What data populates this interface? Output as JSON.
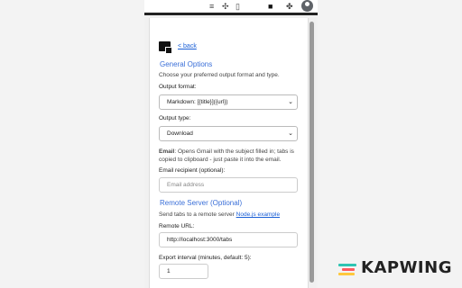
{
  "toolbar": {
    "icons": [
      "menu-icon",
      "puzzle-icon",
      "bookmark-icon",
      "extension-active-icon",
      "extensions-icon",
      "profile-icon"
    ]
  },
  "popup": {
    "back_label": "< back",
    "general": {
      "heading": "General Options",
      "description": "Choose your preferred output format and type.",
      "output_format_label": "Output format:",
      "output_format_value": "Markdown: [{title}]({url})",
      "output_type_label": "Output type:",
      "output_type_value": "Download",
      "email_note_bold": "Email",
      "email_note_rest": ": Opens Gmail with the subject filled in; tabs is copied to clipboard - just paste it into the email.",
      "email_recipient_label": "Email recipient (optional):",
      "email_placeholder": "Email address"
    },
    "remote": {
      "heading": "Remote Server (Optional)",
      "description_prefix": "Send tabs to a remote server ",
      "description_link": "Node.js example",
      "url_label": "Remote URL:",
      "url_value": "http://localhost:3000/tabs",
      "interval_label": "Export interval (minutes, default: 5):",
      "interval_value": "1"
    }
  },
  "watermark": {
    "text": "KAPWING",
    "colors": [
      "#2fc4b2",
      "#ff5a5f",
      "#ffc83d"
    ]
  }
}
